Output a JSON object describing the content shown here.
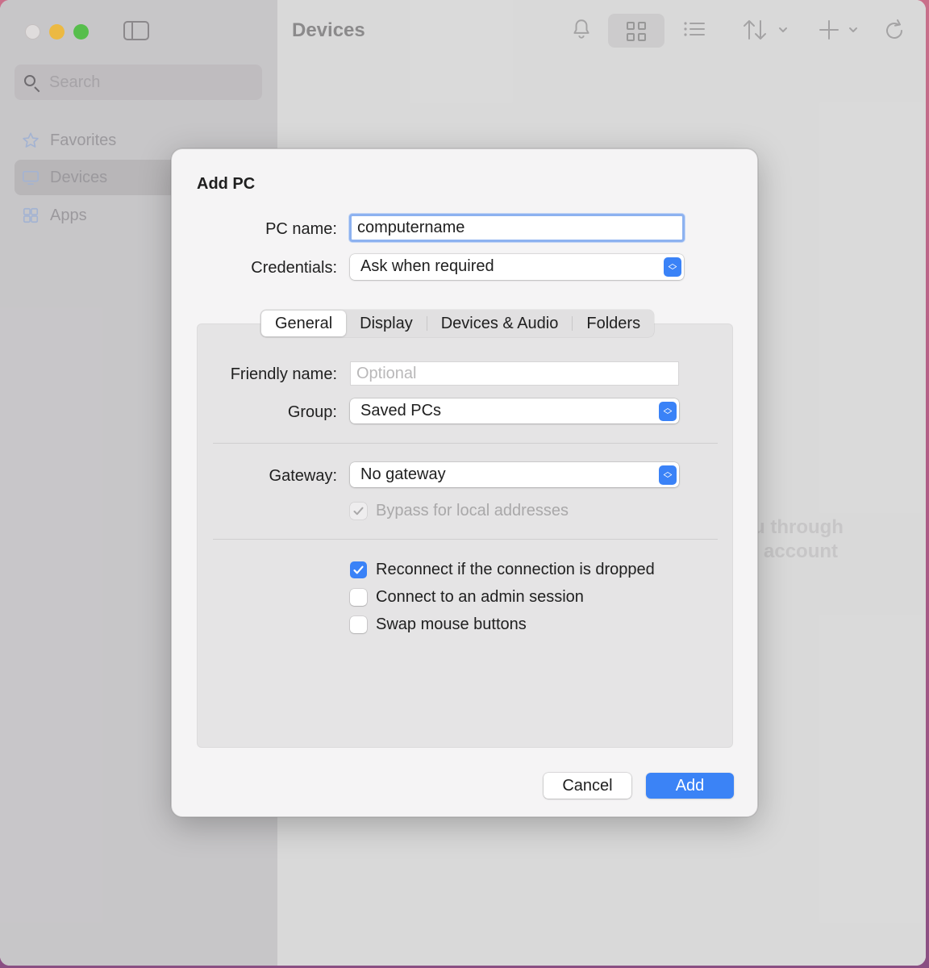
{
  "window": {
    "title": "Devices"
  },
  "sidebar": {
    "search_placeholder": "Search",
    "items": [
      {
        "label": "Favorites",
        "icon": "star-icon"
      },
      {
        "label": "Devices",
        "icon": "monitor-icon"
      },
      {
        "label": "Apps",
        "icon": "apps-icon"
      }
    ]
  },
  "toolbar": {
    "icons": [
      "bell-icon",
      "grid-view-icon",
      "list-view-icon",
      "sort-icon",
      "add-icon",
      "refresh-icon"
    ]
  },
  "background_hint": {
    "line1": "u through",
    "line2": "account"
  },
  "dialog": {
    "title": "Add PC",
    "pc_name_label": "PC name:",
    "pc_name_value": "computername",
    "credentials_label": "Credentials:",
    "credentials_value": "Ask when required",
    "tabs": [
      "General",
      "Display",
      "Devices & Audio",
      "Folders"
    ],
    "selected_tab": "General",
    "friendly_name_label": "Friendly name:",
    "friendly_name_placeholder": "Optional",
    "group_label": "Group:",
    "group_value": "Saved PCs",
    "gateway_label": "Gateway:",
    "gateway_value": "No gateway",
    "bypass_label": "Bypass for local addresses",
    "bypass_checked": true,
    "reconnect_label": "Reconnect if the connection is dropped",
    "reconnect_checked": true,
    "admin_label": "Connect to an admin session",
    "admin_checked": false,
    "swap_label": "Swap mouse buttons",
    "swap_checked": false,
    "cancel_label": "Cancel",
    "add_label": "Add"
  },
  "colors": {
    "accent": "#3b83f6",
    "focus_ring": "#8db2f0"
  }
}
